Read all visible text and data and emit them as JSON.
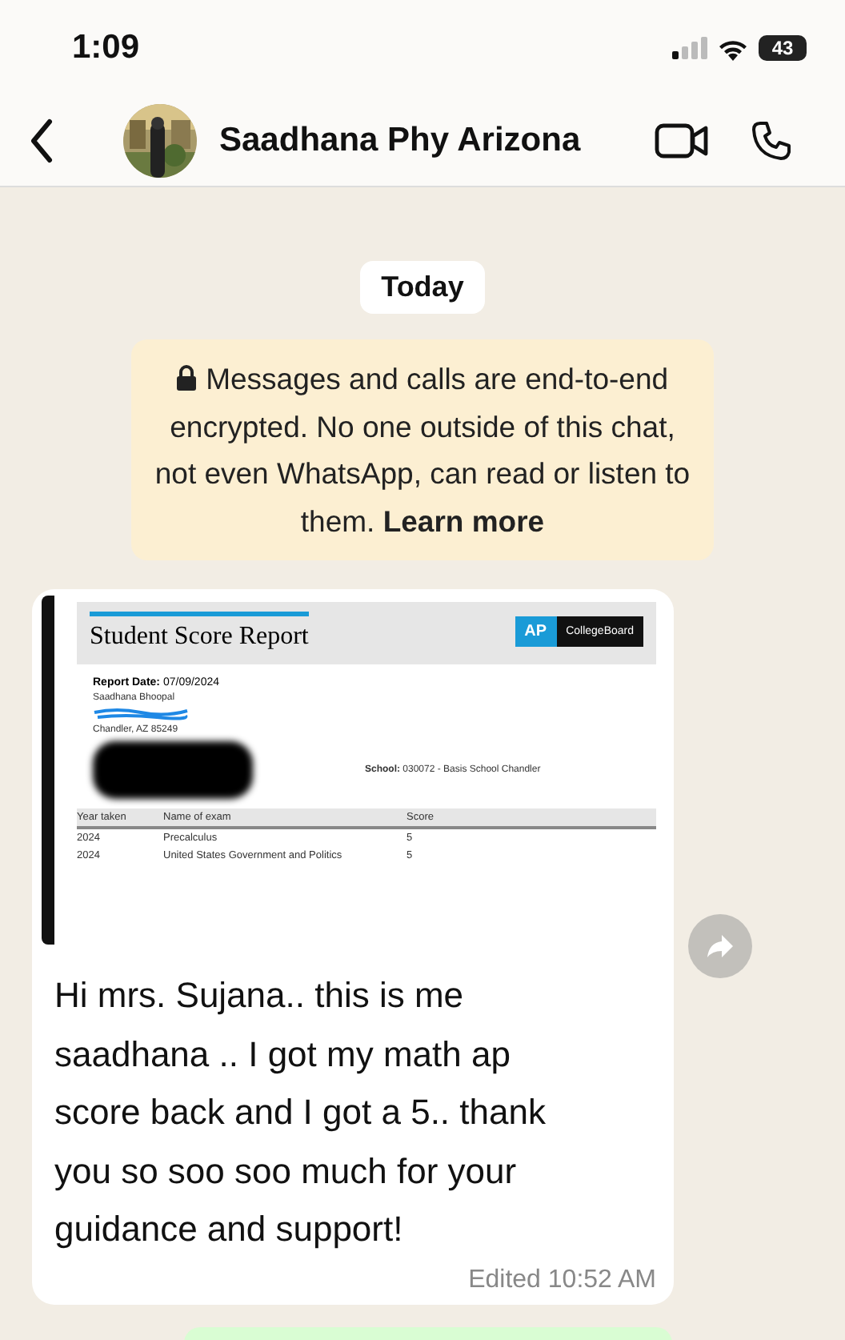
{
  "status_bar": {
    "time": "1:09",
    "battery": "43"
  },
  "header": {
    "contact_name": "Saadhana Phy Arizona"
  },
  "date_chip": "Today",
  "encryption_notice": {
    "text": "Messages and calls are end-to-end encrypted. No one outside of this chat, not even WhatsApp, can read or listen to them.",
    "link": "Learn more"
  },
  "message": {
    "report": {
      "title": "Student Score Report",
      "brand_ap": "AP",
      "brand_name": "CollegeBoard",
      "date_label": "Report Date:",
      "date": "07/09/2024",
      "student": "Saadhana Bhoopal",
      "city": "Chandler, AZ 85249",
      "school_label": "School:",
      "school": "030072 - Basis School Chandler",
      "columns": [
        "Year taken",
        "Name of exam",
        "Score"
      ],
      "rows": [
        [
          "2024",
          "Precalculus",
          "5"
        ],
        [
          "2024",
          "United States Government and Politics",
          "5"
        ]
      ]
    },
    "text": "Hi mrs. Sujana.. this is me saadhana .. I got my math ap score back and I got a 5.. thank you so soo soo much for your guidance and support!",
    "edited": "Edited",
    "time": "10:52 AM"
  }
}
